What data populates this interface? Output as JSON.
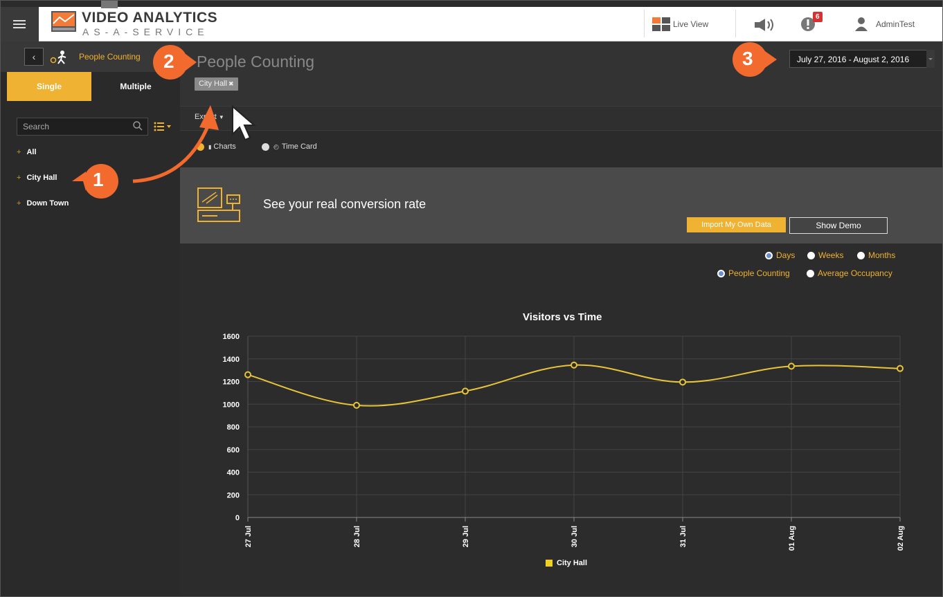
{
  "header": {
    "logo_main": "VIDEO ANALYTICS",
    "logo_sub": "AS-A-SERVICE",
    "live_view_label": "Live View",
    "alert_count": "6",
    "user_name": "AdminTest"
  },
  "sidebar": {
    "title": "People Counting",
    "mode_single": "Single",
    "mode_multiple": "Multiple",
    "search_placeholder": "Search",
    "items": [
      {
        "label": "All"
      },
      {
        "label": "City Hall"
      },
      {
        "label": "Down Town"
      }
    ]
  },
  "main": {
    "page_title": "People Counting",
    "selected_tag": "City Hall",
    "date_range": "July 27, 2016 - August 2, 2016",
    "export_label": "Export",
    "view_options": [
      {
        "label": "Charts",
        "selected": true
      },
      {
        "label": "Time Card",
        "selected": false
      }
    ],
    "banner": {
      "title": "See your real conversion rate",
      "import_label": "Import My Own Data",
      "demo_label": "Show Demo"
    },
    "granularity": [
      {
        "label": "Days",
        "selected": true
      },
      {
        "label": "Weeks",
        "selected": false
      },
      {
        "label": "Months",
        "selected": false
      }
    ],
    "metrics": [
      {
        "label": "People Counting",
        "selected": true
      },
      {
        "label": "Average Occupancy",
        "selected": false
      }
    ]
  },
  "callouts": [
    "1",
    "2",
    "3"
  ],
  "colors": {
    "accent": "#f0b232",
    "callout": "#f26a2e",
    "line": "#e8c43a"
  },
  "chart_data": {
    "type": "line",
    "title": "Visitors vs Time",
    "categories": [
      "27 Jul",
      "28 Jul",
      "29 Jul",
      "30 Jul",
      "31 Jul",
      "01 Aug",
      "02 Aug"
    ],
    "series": [
      {
        "name": "City Hall",
        "values": [
          1260,
          990,
          1115,
          1345,
          1195,
          1335,
          1315
        ]
      }
    ],
    "ylim": [
      0,
      1600
    ],
    "yticks": [
      0,
      200,
      400,
      600,
      800,
      1000,
      1200,
      1400,
      1600
    ],
    "grid": true,
    "legend": "bottom"
  }
}
